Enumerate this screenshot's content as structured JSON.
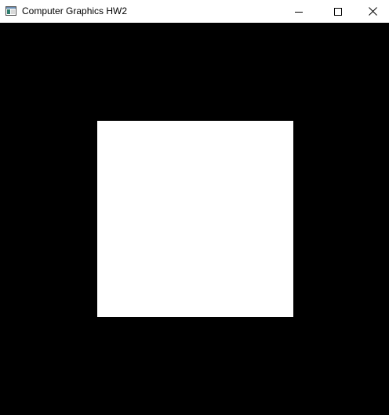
{
  "window": {
    "title": "Computer Graphics HW2"
  },
  "icons": {
    "app": "app-window-icon",
    "minimize": "minimize-icon",
    "maximize": "maximize-icon",
    "close": "close-icon"
  },
  "colors": {
    "canvas_background": "#000000",
    "shape_fill": "#ffffff",
    "titlebar_background": "#ffffff",
    "title_text": "#000000"
  }
}
